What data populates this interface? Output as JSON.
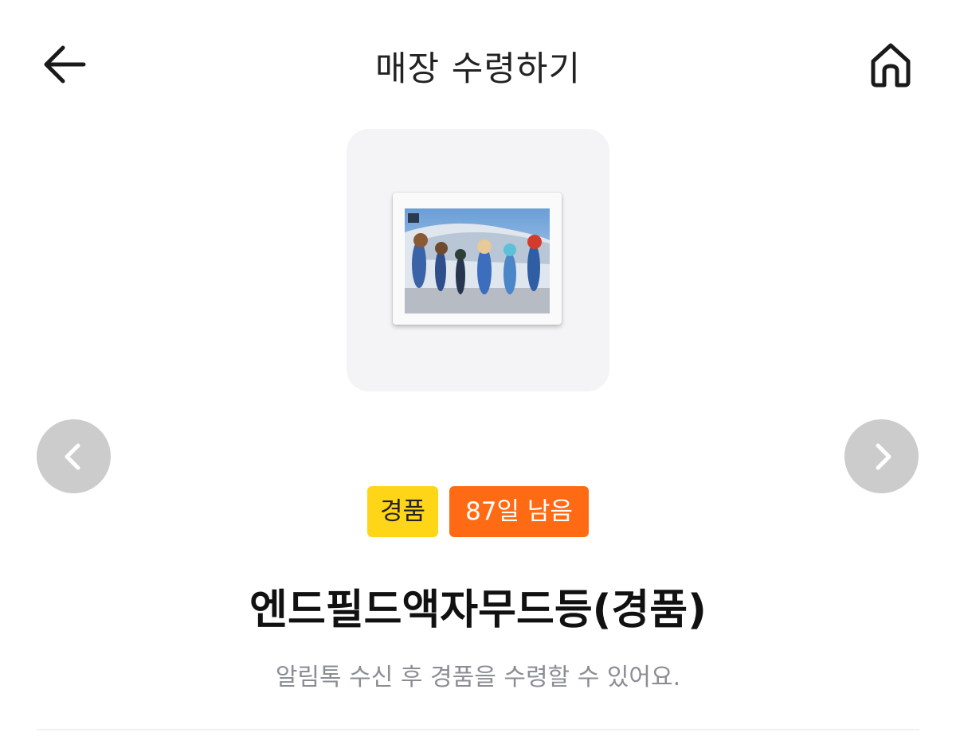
{
  "header": {
    "title": "매장 수령하기",
    "back_icon": "arrow-left-icon",
    "home_icon": "home-icon"
  },
  "product": {
    "image_icon": "framed-art-icon",
    "badges": {
      "gift": "경품",
      "days_left": "87일 남음"
    },
    "name": "엔드필드액자무드등(경품)",
    "description": "알림톡 수신 후 경품을 수령할 수 있어요."
  },
  "carousel": {
    "prev_icon": "chevron-left-icon",
    "next_icon": "chevron-right-icon"
  },
  "colors": {
    "gift_badge": "#ffd617",
    "days_badge": "#ff6a14",
    "nav_button": "#cccccc",
    "card_bg": "#f4f4f6"
  }
}
